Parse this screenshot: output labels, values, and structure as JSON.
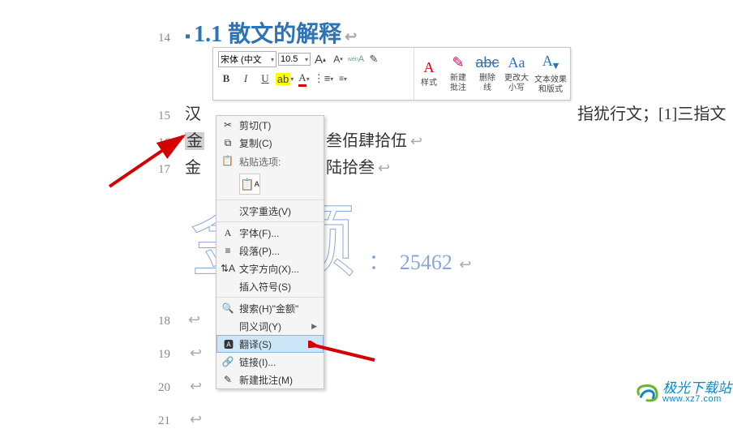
{
  "heading": {
    "number": "1.1",
    "title": "散文的解释"
  },
  "lines": {
    "l14": "14",
    "l15": {
      "n": "15",
      "prefix": "汉",
      "suffix": "指犹行文；[1]三指文"
    },
    "l16": {
      "n": "16",
      "prefix": "金",
      "text": "叁佰肆拾伍"
    },
    "l17": {
      "n": "17",
      "prefix": "金",
      "text": "陆拾叁"
    },
    "l18": "18",
    "l19": "19",
    "l20": "20",
    "l21": "21"
  },
  "watermark": {
    "text": "金额",
    "colon": "：",
    "num": "25462"
  },
  "toolbar": {
    "font_name": "宋体 (中文",
    "font_size": "10.5",
    "grow": "A",
    "shrink": "A",
    "bold": "B",
    "italic": "I",
    "underline": "U",
    "styles_label": "样式",
    "new_comment": "新建\n批注",
    "strike_label": "删除\n线",
    "change_case": "更改大\n小写",
    "text_effects": "文本效果\n和版式"
  },
  "menu": {
    "cut": "剪切(T)",
    "copy": "复制(C)",
    "paste_opts": "粘贴选项:",
    "cjk_reconv": "汉字重选(V)",
    "font": "字体(F)...",
    "paragraph": "段落(P)...",
    "text_dir": "文字方向(X)...",
    "insert_symbol": "插入符号(S)",
    "search_prefix": "搜索(H)\"",
    "search_term": "金额",
    "search_suffix": "\"",
    "synonym": "同义词(Y)",
    "translate": "翻译(S)",
    "link": "链接(I)...",
    "new_comment": "新建批注(M)"
  },
  "footer": {
    "name": "极光下载站",
    "url": "www.xz7.com"
  }
}
